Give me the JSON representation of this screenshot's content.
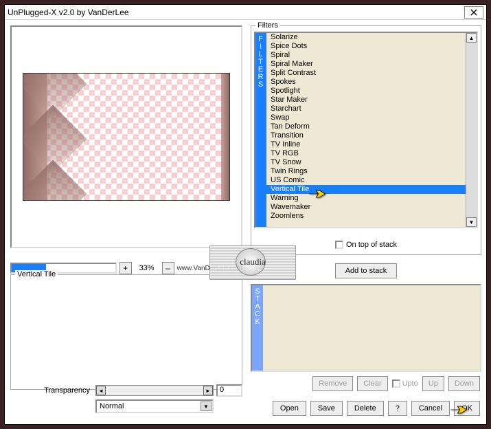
{
  "window": {
    "title": "UnPlugged-X v2.0 by VanDerLee"
  },
  "zoom": {
    "value": "33%",
    "plus": "+",
    "minus": "–"
  },
  "brand": "www.VanDerLee.com",
  "filter_group_label": "Vertical Tile",
  "filters_label": "Filters",
  "filters_tab": [
    "F",
    "I",
    "L",
    "T",
    "E",
    "R",
    "S"
  ],
  "filters": {
    "items": [
      "Solarize",
      "Spice Dots",
      "Spiral",
      "Spiral Maker",
      "Split Contrast",
      "Spokes",
      "Spotlight",
      "Star Maker",
      "Starchart",
      "Swap",
      "Tan Deform",
      "Transition",
      "TV Inline",
      "TV RGB",
      "TV Snow",
      "Twin Rings",
      "US Comic",
      "Vertical Tile",
      "Warning",
      "Wavemaker",
      "Zoomlens"
    ],
    "selected": "Vertical Tile"
  },
  "ontop": "On top of stack",
  "addstack": "Add to stack",
  "stack_tab": [
    "S",
    "T",
    "A",
    "C",
    "K"
  ],
  "stack_btns": {
    "remove": "Remove",
    "clear": "Clear",
    "upto": "Upto",
    "up": "Up",
    "down": "Down"
  },
  "bottom_btns": {
    "open": "Open",
    "save": "Save",
    "delete": "Delete",
    "help": "?",
    "cancel": "Cancel",
    "ok": "OK"
  },
  "transparency": {
    "label": "Transparency",
    "value": "0"
  },
  "blend": {
    "value": "Normal"
  },
  "watermark": "claudia"
}
